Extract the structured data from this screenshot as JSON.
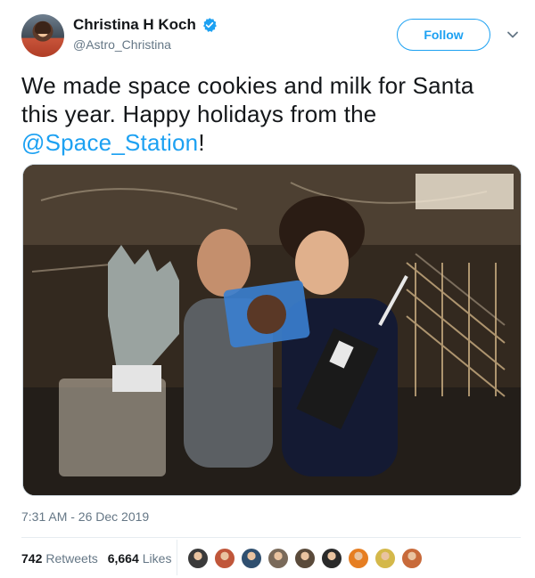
{
  "author": {
    "display_name": "Christina H Koch",
    "handle": "@Astro_Christina",
    "verified": true,
    "avatar": "astronaut-avatar"
  },
  "actions": {
    "follow_label": "Follow",
    "menu_icon": "chevron-down-icon"
  },
  "tweet": {
    "text_line": "We made space cookies and milk for Santa this year. Happy holidays from the ",
    "mention": "@Space_Station",
    "text_end": "!",
    "photo": "astronauts-with-cookies-photo"
  },
  "meta": {
    "timestamp": "7:31 AM - 26 Dec 2019"
  },
  "stats": {
    "retweets_count": "742",
    "retweets_label": "Retweets",
    "likes_count": "6,664",
    "likes_label": "Likes"
  },
  "likers": [
    {
      "name": "liker-avatar-1",
      "color": "#3a3a3a"
    },
    {
      "name": "liker-avatar-2",
      "color": "#c0563a"
    },
    {
      "name": "liker-avatar-3",
      "color": "#2f4f6f"
    },
    {
      "name": "liker-avatar-4",
      "color": "#7a6a5a"
    },
    {
      "name": "liker-avatar-5",
      "color": "#5a4a3a"
    },
    {
      "name": "liker-avatar-6",
      "color": "#2a2a2a"
    },
    {
      "name": "liker-avatar-7",
      "color": "#e67e22"
    },
    {
      "name": "liker-avatar-8",
      "color": "#d4b84a"
    },
    {
      "name": "liker-avatar-9",
      "color": "#c86a3a"
    }
  ],
  "colors": {
    "accent": "#1da1f2",
    "secondary_text": "#657786",
    "primary_text": "#14171a"
  }
}
